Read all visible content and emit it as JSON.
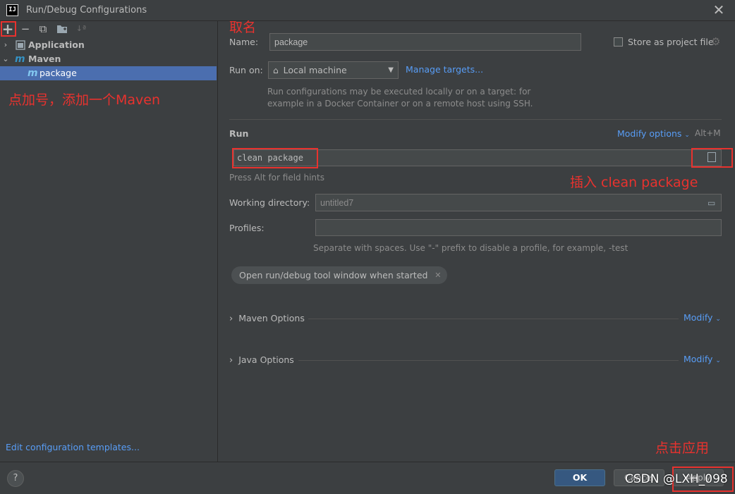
{
  "window": {
    "title": "Run/Debug Configurations",
    "app_icon_text": "IJ"
  },
  "toolbar": {
    "add": "+",
    "remove": "−",
    "copy": "⧉",
    "folder": "▭",
    "sort": "↓ª"
  },
  "tree": {
    "items": [
      {
        "label": "Application",
        "expanded": false
      },
      {
        "label": "Maven",
        "expanded": true
      },
      {
        "label": "package",
        "selected": true
      }
    ],
    "maven_glyph": "m"
  },
  "left_footer": {
    "edit_templates": "Edit configuration templates..."
  },
  "form": {
    "name_label": "Name:",
    "name_value": "package",
    "store_label": "Store as project file",
    "run_on_label": "Run on:",
    "run_on_value": "Local machine",
    "manage_targets": "Manage targets...",
    "run_on_hint_1": "Run configurations may be executed locally or on a target: for",
    "run_on_hint_2": "example in a Docker Container or on a remote host using SSH.",
    "run_section": "Run",
    "modify_options": "Modify options",
    "modify_shortcut": "Alt+M",
    "command_value": "clean package",
    "alt_hint": "Press Alt for field hints",
    "workdir_label": "Working directory:",
    "workdir_value": "untitled7",
    "profiles_label": "Profiles:",
    "profiles_value": "",
    "profiles_hint": "Separate with spaces. Use \"-\" prefix to disable a profile, for example, -test",
    "tag_label": "Open run/debug tool window when started",
    "maven_options": "Maven Options",
    "java_options": "Java Options",
    "modify": "Modify"
  },
  "annotations": {
    "name_note": "取名",
    "add_note": "点加号，添加一个Maven",
    "insert_note": "插入 clean package",
    "apply_note": "点击应用"
  },
  "buttons": {
    "ok": "OK",
    "cancel": "Cancel",
    "apply": "Apply",
    "help": "?"
  },
  "watermark": "CSDN @LXH_098",
  "colors": {
    "accent": "#589df6",
    "selection": "#4b6eaf",
    "annotation": "#e8322e",
    "ok_button": "#365880"
  }
}
